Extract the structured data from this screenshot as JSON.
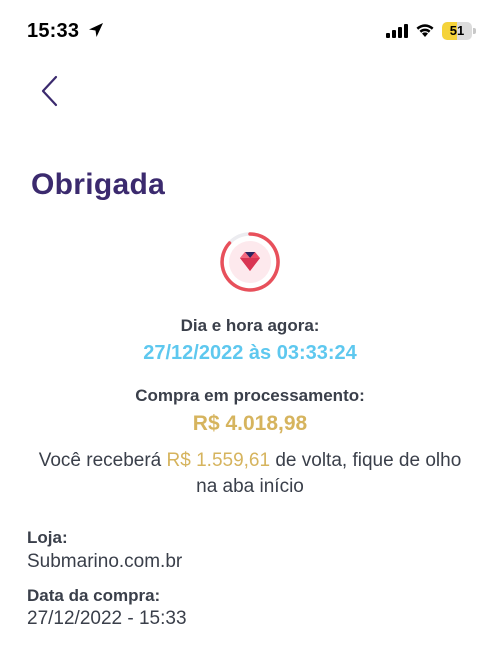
{
  "status_bar": {
    "time": "15:33",
    "battery_level": "51",
    "battery_fraction": 0.51,
    "icons": [
      "location-arrow-icon",
      "signal-bars-icon",
      "wifi-icon",
      "battery-icon"
    ]
  },
  "header": {
    "back_icon": "chevron-left-icon",
    "title": "Obrigada"
  },
  "status_icon": "gem-progress-icon",
  "purchase": {
    "datetime_label": "Dia e hora agora:",
    "datetime_value": "27/12/2022 às 03:33:24",
    "status_label": "Compra em processamento:",
    "amount": "R$ 4.018,98",
    "cashback_prefix": "Você receberá ",
    "cashback_amount": "R$ 1.559,61",
    "cashback_suffix": " de volta, fique de olho na aba início"
  },
  "details": {
    "store_label": "Loja:",
    "store_value": "Submarino.com.br",
    "date_label": "Data da compra:",
    "date_value": "27/12/2022 - 15:33"
  },
  "colors": {
    "title": "#3b2a6e",
    "accent_blue": "#5ec8ef",
    "accent_gold": "#d6b45e",
    "ring_red": "#e8505b",
    "text": "#3a3f4a"
  }
}
